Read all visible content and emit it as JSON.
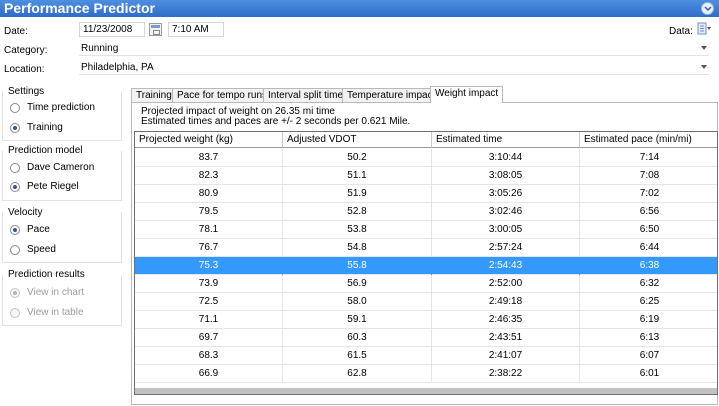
{
  "app": {
    "title": "Performance Predictor"
  },
  "header": {
    "date_label": "Date:",
    "date_value": "11/23/2008",
    "time_value": "7:10 AM",
    "data_label": "Data:",
    "category_label": "Category:",
    "category_value": "Running",
    "location_label": "Location:",
    "location_value": "Philadelphia, PA"
  },
  "sidebar": {
    "settings": {
      "title": "Settings",
      "options": [
        "Time prediction",
        "Training"
      ],
      "selected": 1
    },
    "model": {
      "title": "Prediction model",
      "options": [
        "Dave Cameron",
        "Pete Riegel"
      ],
      "selected": 1
    },
    "velocity": {
      "title": "Velocity",
      "options": [
        "Pace",
        "Speed"
      ],
      "selected": 0
    },
    "results": {
      "title": "Prediction results",
      "options": [
        "View in chart",
        "View in table"
      ],
      "selected": 0
    }
  },
  "tabs": [
    "Training",
    "Pace for tempo runs",
    "Interval split times",
    "Temperature impact",
    "Weight impact"
  ],
  "active_tab": 4,
  "panel": {
    "info_line1": "Projected impact of weight on 26.35 mi time",
    "info_line2": "Estimated times and paces are +/- 2 seconds per 0.621 Mile."
  },
  "table": {
    "columns": [
      "Projected weight (kg)",
      "Adjusted VDOT",
      "Estimated time",
      "Estimated pace (min/mi)"
    ],
    "rows": [
      [
        "83.7",
        "50.2",
        "3:10:44",
        "7:14"
      ],
      [
        "82.3",
        "51.1",
        "3:08:05",
        "7:08"
      ],
      [
        "80.9",
        "51.9",
        "3:05:26",
        "7:02"
      ],
      [
        "79.5",
        "52.8",
        "3:02:46",
        "6:56"
      ],
      [
        "78.1",
        "53.8",
        "3:00:05",
        "6:50"
      ],
      [
        "76.7",
        "54.8",
        "2:57:24",
        "6:44"
      ],
      [
        "75.3",
        "55.8",
        "2:54:43",
        "6:38"
      ],
      [
        "73.9",
        "56.9",
        "2:52:00",
        "6:32"
      ],
      [
        "72.5",
        "58.0",
        "2:49:18",
        "6:25"
      ],
      [
        "71.1",
        "59.1",
        "2:46:35",
        "6:19"
      ],
      [
        "69.7",
        "60.3",
        "2:43:51",
        "6:13"
      ],
      [
        "68.3",
        "61.5",
        "2:41:07",
        "6:07"
      ],
      [
        "66.9",
        "62.8",
        "2:38:22",
        "6:01"
      ]
    ],
    "selected_row": 6
  },
  "colors": {
    "titlebar": "#2f6cc8",
    "selection": "#3399ff"
  },
  "icons": {
    "collapse": "chevron-down-icon",
    "calendar": "calendar-icon",
    "data": "data-menu-icon"
  }
}
